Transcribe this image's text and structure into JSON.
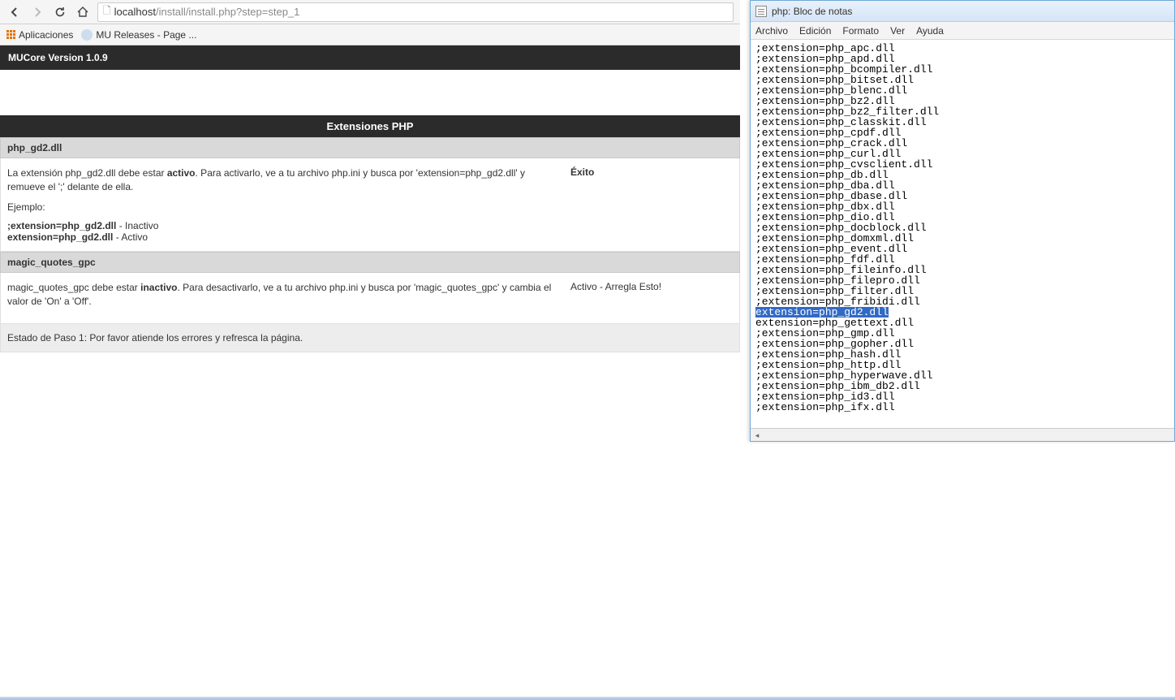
{
  "browser": {
    "url_host": "localhost",
    "url_path": "/install/install.php?step=step_1",
    "bookmarks": {
      "apps_label": "Aplicaciones",
      "mu_releases": "MU Releases - Page ..."
    }
  },
  "page": {
    "header": "MUCore Version 1.0.9",
    "section_title": "Extensiones PHP",
    "gd2": {
      "title": "php_gd2.dll",
      "desc_prefix": "La extensión php_gd2.dll debe estar ",
      "desc_strong": "activo",
      "desc_suffix": ". Para activarlo, ve a tu archivo php.ini y busca por 'extension=php_gd2.dll' y remueve el ';' delante de ella.",
      "example_label": "Ejemplo:",
      "ex_inactive_bold": ";extension=php_gd2.dll",
      "ex_inactive_suffix": " - Inactivo",
      "ex_active_bold": "extension=php_gd2.dll",
      "ex_active_suffix": " - Activo",
      "status": "Éxito"
    },
    "magic": {
      "title": "magic_quotes_gpc",
      "desc_prefix": "magic_quotes_gpc debe estar ",
      "desc_strong": "inactivo",
      "desc_suffix": ". Para desactivarlo, ve a tu archivo php.ini y busca por 'magic_quotes_gpc' y cambia el valor de 'On' a 'Off'.",
      "status": "Activo - Arregla Esto!"
    },
    "footer_status": "Estado de Paso 1: Por favor atiende los errores y refresca la página."
  },
  "notepad": {
    "title": "php: Bloc de notas",
    "menu": {
      "file": "Archivo",
      "edit": "Edición",
      "format": "Formato",
      "view": "Ver",
      "help": "Ayuda"
    },
    "lines": [
      ";extension=php_apc.dll",
      ";extension=php_apd.dll",
      ";extension=php_bcompiler.dll",
      ";extension=php_bitset.dll",
      ";extension=php_blenc.dll",
      ";extension=php_bz2.dll",
      ";extension=php_bz2_filter.dll",
      ";extension=php_classkit.dll",
      ";extension=php_cpdf.dll",
      ";extension=php_crack.dll",
      ";extension=php_curl.dll",
      ";extension=php_cvsclient.dll",
      ";extension=php_db.dll",
      ";extension=php_dba.dll",
      ";extension=php_dbase.dll",
      ";extension=php_dbx.dll",
      ";extension=php_dio.dll",
      ";extension=php_docblock.dll",
      ";extension=php_domxml.dll",
      ";extension=php_event.dll",
      ";extension=php_fdf.dll",
      ";extension=php_fileinfo.dll",
      ";extension=php_filepro.dll",
      ";extension=php_filter.dll",
      ";extension=php_fribidi.dll",
      "extension=php_gd2.dll",
      "extension=php_gettext.dll",
      ";extension=php_gmp.dll",
      ";extension=php_gopher.dll",
      ";extension=php_hash.dll",
      ";extension=php_http.dll",
      ";extension=php_hyperwave.dll",
      ";extension=php_ibm_db2.dll",
      ";extension=php_id3.dll",
      ";extension=php_ifx.dll"
    ],
    "selected_index": 25
  }
}
